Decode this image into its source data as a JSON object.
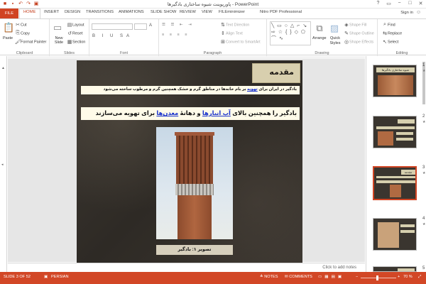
{
  "window": {
    "title": "پاورپوینت شیوه ساختاری بادگیرها - PowerPoint",
    "controls": {
      "help": "?",
      "restore": "▭",
      "minimize": "−",
      "maximize": "□",
      "close": "✕"
    }
  },
  "tabs": [
    "FILE",
    "HOME",
    "INSERT",
    "DESIGN",
    "TRANSITIONS",
    "ANIMATIONS",
    "SLIDE SHOW",
    "REVIEW",
    "VIEW",
    "FILEminimizer",
    "Nitro PDF Professional"
  ],
  "account": {
    "sign_in": "Sign in"
  },
  "ribbon": {
    "clipboard": {
      "label": "Clipboard",
      "paste": "Paste",
      "cut": "Cut",
      "copy": "Copy",
      "format_painter": "Format Painter"
    },
    "slides": {
      "label": "Slides",
      "new_slide": "New Slide",
      "layout": "Layout",
      "reset": "Reset",
      "section": "Section"
    },
    "font": {
      "label": "Font"
    },
    "paragraph": {
      "label": "Paragraph",
      "text_direction": "Text Direction",
      "align_text": "Align Text",
      "convert_smartart": "Convert to SmartArt"
    },
    "drawing": {
      "label": "Drawing",
      "arrange": "Arrange",
      "quick_styles": "Quick Styles",
      "shape_fill": "Shape Fill",
      "shape_outline": "Shape Outline",
      "shape_effects": "Shape Effects"
    },
    "editing": {
      "label": "Editing",
      "find": "Find",
      "replace": "Replace",
      "select": "Select"
    }
  },
  "slide": {
    "title": "مقدمه",
    "line1_prefix": "بادگیر در ایران برای ",
    "line1_link": "تهویه",
    "line1_suffix": " بر بام خانه‌ها در مناطق گرم و خشک همچنین گرم و مرطوب ساخته می‌شود",
    "line2_prefix": "بادگیر را همچنین بالای ",
    "line2_link1": "آب انبارها",
    "line2_mid": " و دهانهٔ ",
    "line2_link2": "معدن‌ها",
    "line2_suffix": " برای تهویه می‌سازند",
    "caption": "تصویر ۱: بادگیر"
  },
  "thumbnails": [
    {
      "num": "1",
      "title": "شیوه ساختاری بادگیرها"
    },
    {
      "num": "2",
      "title": ""
    },
    {
      "num": "3",
      "title": "مقدمه"
    },
    {
      "num": "4",
      "title": ""
    },
    {
      "num": "5",
      "title": ""
    }
  ],
  "notes": {
    "placeholder": "Click to add notes"
  },
  "status": {
    "slide_of": "SLIDE 3 OF 52",
    "language": "PERSIAN",
    "notes": "NOTES",
    "comments": "COMMENTS",
    "zoom": "70 %"
  }
}
